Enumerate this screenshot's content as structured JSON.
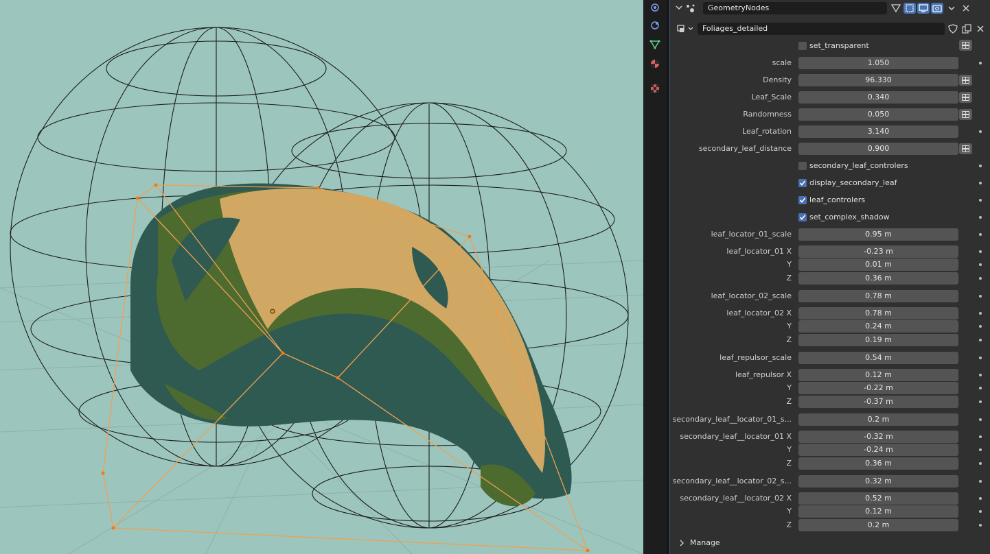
{
  "viewport": {
    "background_color": "#9cc5bd",
    "description_icons": [
      "wireframe-sphere",
      "foliage-mesh",
      "lattice-cage"
    ]
  },
  "side_tabs": [
    {
      "name": "scene-tab",
      "icon": "scene-icon"
    },
    {
      "name": "physics-tab",
      "icon": "physics-icon"
    },
    {
      "name": "data-tab",
      "icon": "mesh-data-icon"
    },
    {
      "name": "material-tab",
      "icon": "material-icon"
    },
    {
      "name": "texture-tab",
      "icon": "texture-icon"
    }
  ],
  "modifier": {
    "name": "GeometryNodes",
    "node_group": "Foliages_detailed",
    "collapsed_icon": "chevron-down-icon",
    "manage_label": "Manage"
  },
  "params": {
    "set_transparent": {
      "label": "set_transparent",
      "checked": false
    },
    "scale": {
      "label": "scale",
      "value": "1.050"
    },
    "density": {
      "label": "Density",
      "value": "96.330"
    },
    "leaf_scale": {
      "label": "Leaf_Scale",
      "value": "0.340"
    },
    "randomness": {
      "label": "Randomness",
      "value": "0.050"
    },
    "leaf_rotation": {
      "label": "Leaf_rotation",
      "value": "3.140"
    },
    "secondary_leaf_distance": {
      "label": "secondary_leaf_distance",
      "value": "0.900"
    },
    "secondary_leaf_controlers": {
      "label": "secondary_leaf_controlers",
      "checked": false
    },
    "display_secondary_leaf": {
      "label": "display_secondary_leaf",
      "checked": true
    },
    "leaf_controlers": {
      "label": "leaf_controlers",
      "checked": true
    },
    "set_complex_shadow": {
      "label": "set_complex_shadow",
      "checked": true
    },
    "leaf_locator_01_scale": {
      "label": "leaf_locator_01_scale",
      "value": "0.95 m"
    },
    "leaf_locator_01": {
      "label": "leaf_locator_01 X",
      "x": "-0.23 m",
      "y": "0.01 m",
      "z": "0.36 m"
    },
    "leaf_locator_02_scale": {
      "label": "leaf_locator_02_scale",
      "value": "0.78 m"
    },
    "leaf_locator_02": {
      "label": "leaf_locator_02 X",
      "x": "0.78 m",
      "y": "0.24 m",
      "z": "0.19 m"
    },
    "leaf_repulsor_scale": {
      "label": "leaf_repulsor_scale",
      "value": "0.54 m"
    },
    "leaf_repulsor": {
      "label": "leaf_repulsor X",
      "x": "0.12 m",
      "y": "-0.22 m",
      "z": "-0.37 m"
    },
    "sec_01_scale": {
      "label": "secondary_leaf__locator_01_s...",
      "value": "0.2 m"
    },
    "sec_01": {
      "label": "secondary_leaf__locator_01 X",
      "x": "-0.32 m",
      "y": "-0.24 m",
      "z": "0.36 m"
    },
    "sec_02_scale": {
      "label": "secondary_leaf__locator_02_s...",
      "value": "0.32 m"
    },
    "sec_02": {
      "label": "secondary_leaf__locator_02 X",
      "x": "0.52 m",
      "y": "0.12 m",
      "z": "0.2 m"
    },
    "axis_y": "Y",
    "axis_z": "Z"
  }
}
